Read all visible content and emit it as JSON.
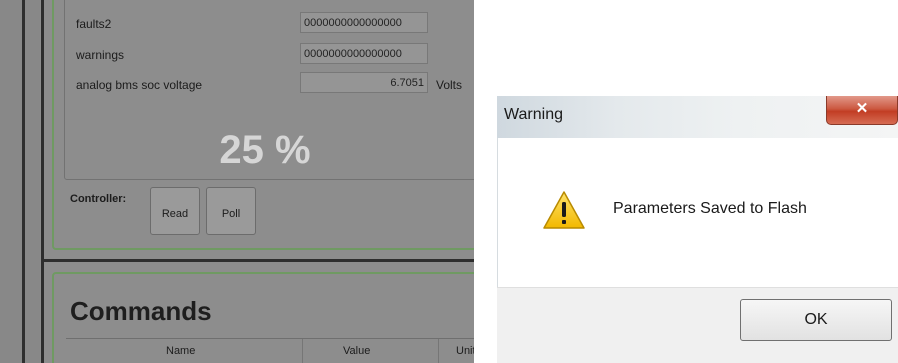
{
  "monitor": {
    "rows": [
      {
        "label": "faults2",
        "value": "0000000000000000"
      },
      {
        "label": "warnings",
        "value": "0000000000000000"
      },
      {
        "label": "analog bms soc voltage",
        "value": "6.7051",
        "units": "Volts"
      }
    ],
    "soc_percent": "25 %",
    "controller_label": "Controller:",
    "read_label": "Read",
    "poll_label": "Poll"
  },
  "commands": {
    "title": "Commands",
    "columns": [
      "Name",
      "Value",
      "Units"
    ]
  },
  "dialog": {
    "title": "Warning",
    "close_glyph": "✕",
    "message": "Parameters Saved to Flash",
    "ok_label": "OK",
    "icon": "warning-triangle-icon"
  },
  "colors": {
    "panel_gray": "#8d8d8d",
    "group_border_green": "#6f9a62",
    "close_red": "#c23d24",
    "warning_yellow": "#f2c300"
  }
}
